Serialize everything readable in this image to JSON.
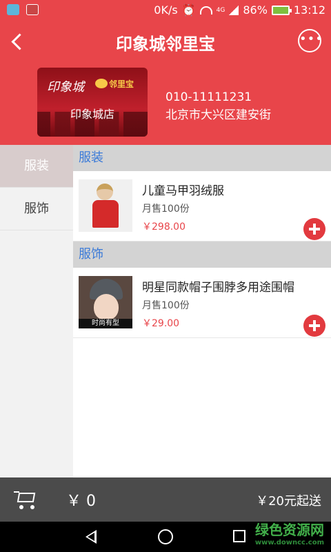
{
  "status_bar": {
    "speed": "0K/s",
    "network": "4G",
    "battery": "86%",
    "time": "13:12"
  },
  "header": {
    "title": "印象城邻里宝",
    "more_glyph": "•••"
  },
  "store": {
    "card_brand": "印象城",
    "card_logo_text": "邻里宝",
    "card_name": "印象城店",
    "phone": "010-11111231",
    "address": "北京市大兴区建安街"
  },
  "categories": [
    {
      "label": "服装",
      "active": true
    },
    {
      "label": "服饰",
      "active": false
    }
  ],
  "sections": [
    {
      "title": "服装",
      "products": [
        {
          "name": "儿童马甲羽绒服",
          "sales": "月售100份",
          "price": "￥298.00",
          "image": "child-vest-photo"
        }
      ]
    },
    {
      "title": "服饰",
      "products": [
        {
          "name": "明星同款帽子围脖多用途围帽",
          "sales": "月售100份",
          "price": "￥29.00",
          "image": "woman-hat-photo",
          "image_caption": "时尚有型"
        }
      ]
    }
  ],
  "cart": {
    "total": "￥ 0",
    "min_order": "￥20元起送"
  },
  "watermark": {
    "main": "绿色资源网",
    "url": "www.downcc.com"
  },
  "colors": {
    "brand_red": "#e8454a",
    "section_blue": "#3a7ad8",
    "cart_bar": "#4b4b4b"
  }
}
